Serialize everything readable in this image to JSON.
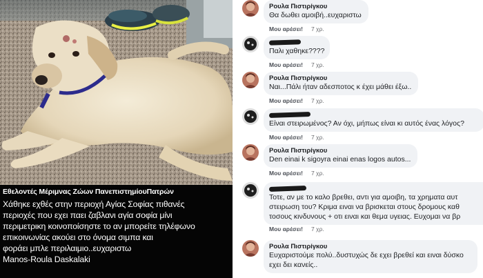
{
  "post": {
    "page_name": "Εθελοντές Μέριμνας Ζώων ΠανεπιστημίουΠατρών",
    "lines": [
      "Χάθηκε εχθές στην περιοχή Αγίας Σοφίας πιθανές",
      "περιοχές που εχει παει ζαβλανι αγία σοφία μίνι",
      "περιμετρικη κοινοποίσηστε το αν μπορείτε τηλέφωνο",
      "επικοινωνίας                 ακούει στο όνομα σιμπα και",
      "φοράει μπλε περιλαιμιο..ευχαριστω",
      "Manos-Roula Daskalaki"
    ]
  },
  "comments": [
    {
      "author": "Ρουλα Πιστιρίγκου",
      "text": [
        "Θα δωθει αμοιβή..ευχαριστω"
      ],
      "like_label": "Μου αρέσει!",
      "time": "7 χρ."
    },
    {
      "author": "",
      "text": [
        "Παλι χαθηκε????"
      ],
      "like_label": "Μου αρέσει!",
      "time": "7 χρ."
    },
    {
      "author": "Ρουλα Πιστιρίγκου",
      "text": [
        "Ναι...Πάλι ήταν αδεσποτος κ έχει μάθει έξω.."
      ],
      "like_label": "Μου αρέσει!",
      "time": "7 χρ."
    },
    {
      "author": "",
      "text": [
        "Είναι στειρωμένος? Αν όχι, μήπως είναι κι αυτός ένας λόγος?"
      ],
      "like_label": "Μου αρέσει!",
      "time": "7 χρ."
    },
    {
      "author": "Ρουλα Πιστιρίγκου",
      "text": [
        "Den einai k sigoyra einai enas logos autos..."
      ],
      "like_label": "Μου αρέσει!",
      "time": "7 χρ."
    },
    {
      "author": "",
      "text": [
        "Τοτε, αν με το καλο βρεθει, αντι για αμοιβη, τα χρηματα αυτ",
        "στειρωση του? Κριμα ειναι να βρισκεται στους δρομους καθ",
        "τοσους κινδυνους + οτι ειναι και θεμα υγειας. Ευχομαι να βρ"
      ],
      "like_label": "Μου αρέσει!",
      "time": "7 χρ."
    },
    {
      "author": "Ρουλα Πιστιρίγκου",
      "text": [
        "Ευχαριστούμε πολύ..δυστυχώς δε εχει βρεθεί και ειναι δύσκο",
        "εχει δει κανείς.."
      ],
      "like_label": "",
      "time": ""
    }
  ],
  "colors": {
    "bubble": "#f0f2f5",
    "text": "#1c1e21",
    "meta": "#65676b",
    "post_bg": "#050505"
  }
}
